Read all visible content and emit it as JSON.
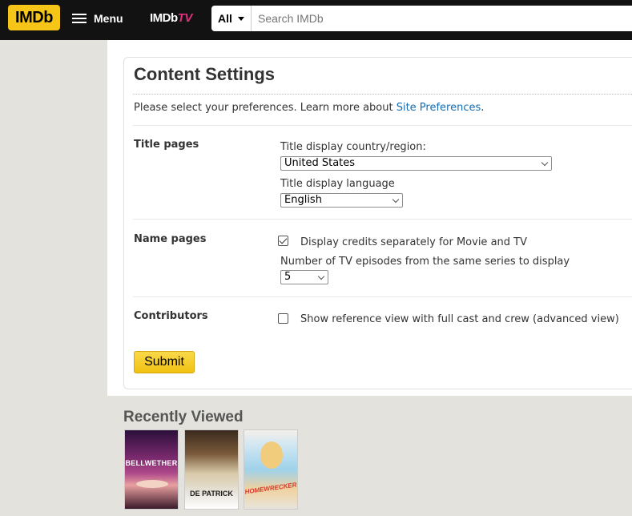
{
  "topbar": {
    "logo": "IMDb",
    "menu_label": "Menu",
    "imdbtv_main": "IMDb",
    "imdbtv_suffix": "TV",
    "search_category": "All",
    "search_placeholder": "Search IMDb"
  },
  "settings": {
    "title": "Content Settings",
    "intro_text": "Please select your preferences. Learn more about ",
    "intro_link": "Site Preferences",
    "intro_end": ".",
    "title_pages": {
      "label": "Title pages",
      "country_label": "Title display country/region:",
      "country_value": "United States",
      "language_label": "Title display language",
      "language_value": "English"
    },
    "name_pages": {
      "label": "Name pages",
      "credits_checkbox_label": "Display credits separately for Movie and TV",
      "credits_checked": true,
      "episodes_label": "Number of TV episodes from the same series to display",
      "episodes_value": "5"
    },
    "contributors": {
      "label": "Contributors",
      "reference_checkbox_label": "Show reference view with full cast and crew (advanced view)",
      "reference_checked": false
    },
    "submit_label": "Submit"
  },
  "recently_viewed": {
    "title": "Recently Viewed",
    "posters": [
      {
        "title": "BELLWETHER"
      },
      {
        "title": "DE PATRICK"
      },
      {
        "title": "HOMEWRECKER"
      }
    ]
  },
  "colors": {
    "imdb_yellow": "#f5c518",
    "topbar_bg": "#121212",
    "link_blue": "#136cb2",
    "page_bg": "#e3e2dd"
  }
}
